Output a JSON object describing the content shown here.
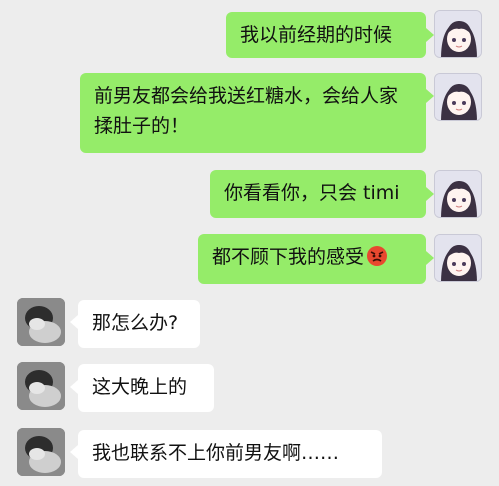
{
  "messages": [
    {
      "side": "me",
      "text": "我以前经期的时候"
    },
    {
      "side": "me",
      "text": "前男友都会给我送红糖水，会给人家揉肚子的！"
    },
    {
      "side": "me",
      "text": "你看看你，只会 timi"
    },
    {
      "side": "me",
      "text": "都不顾下我的感受",
      "emoji": "angry-face-icon"
    },
    {
      "side": "other",
      "text": "那怎么办?"
    },
    {
      "side": "other",
      "text": "这大晚上的"
    },
    {
      "side": "other",
      "text": "我也联系不上你前男友啊……"
    }
  ],
  "colors": {
    "background": "#ededed",
    "my_bubble": "#95ec69",
    "their_bubble": "#ffffff"
  }
}
